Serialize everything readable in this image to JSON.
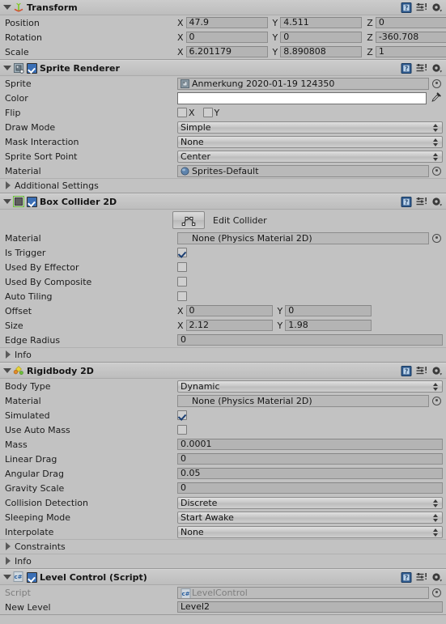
{
  "panel": {
    "name": "Unity Inspector"
  },
  "header_icons": {
    "help": "help-book-icon",
    "preset": "preset-icon",
    "settings": "gear-icon"
  },
  "components": [
    {
      "id": "transform",
      "title": "Transform",
      "icon": "transform-axis-icon",
      "has_checkbox": false,
      "rows": [
        {
          "label": "Position",
          "type": "vector3",
          "x": "47.9",
          "y": "4.511",
          "z": "0"
        },
        {
          "label": "Rotation",
          "type": "vector3",
          "x": "0",
          "y": "0",
          "z": "-360.708"
        },
        {
          "label": "Scale",
          "type": "vector3",
          "x": "6.201179",
          "y": "8.890808",
          "z": "1"
        }
      ]
    },
    {
      "id": "sprite-renderer",
      "title": "Sprite Renderer",
      "icon": "sprite-renderer-icon",
      "has_checkbox": true,
      "enabled": true,
      "rows": [
        {
          "label": "Sprite",
          "type": "object",
          "value": "Anmerkung 2020-01-19 124350",
          "icon": "sprite-asset-icon"
        },
        {
          "label": "Color",
          "type": "color",
          "value": "#ffffff"
        },
        {
          "label": "Flip",
          "type": "flip",
          "x_label": "X",
          "y_label": "Y",
          "x_checked": false,
          "y_checked": false
        },
        {
          "label": "Draw Mode",
          "type": "dropdown",
          "value": "Simple"
        },
        {
          "label": "Mask Interaction",
          "type": "dropdown",
          "value": "None"
        },
        {
          "label": "Sprite Sort Point",
          "type": "dropdown",
          "value": "Center"
        },
        {
          "label": "Material",
          "type": "object",
          "value": "Sprites-Default",
          "icon": "material-sphere-icon"
        },
        {
          "label": "Additional Settings",
          "type": "foldout"
        }
      ]
    },
    {
      "id": "box-collider-2d",
      "title": "Box Collider 2D",
      "icon": "box-collider-2d-icon",
      "has_checkbox": true,
      "enabled": true,
      "rows": [
        {
          "label": "Edit Collider",
          "type": "button",
          "icon": "edit-collider-icon"
        },
        {
          "label": "Material",
          "type": "object",
          "value": "None (Physics Material 2D)",
          "icon": "none-icon"
        },
        {
          "label": "Is Trigger",
          "type": "checkbox",
          "checked": true
        },
        {
          "label": "Used By Effector",
          "type": "checkbox",
          "checked": false
        },
        {
          "label": "Used By Composite",
          "type": "checkbox",
          "checked": false
        },
        {
          "label": "Auto Tiling",
          "type": "checkbox",
          "checked": false
        },
        {
          "label": "Offset",
          "type": "vector2",
          "x": "0",
          "y": "0"
        },
        {
          "label": "Size",
          "type": "vector2",
          "x": "2.12",
          "y": "1.98"
        },
        {
          "label": "Edge Radius",
          "type": "text",
          "value": "0"
        },
        {
          "label": "Info",
          "type": "foldout"
        }
      ]
    },
    {
      "id": "rigidbody-2d",
      "title": "Rigidbody 2D",
      "icon": "rigidbody-2d-icon",
      "has_checkbox": false,
      "rows": [
        {
          "label": "Body Type",
          "type": "dropdown",
          "value": "Dynamic"
        },
        {
          "label": "Material",
          "type": "object",
          "value": "None (Physics Material 2D)",
          "icon": "none-icon"
        },
        {
          "label": "Simulated",
          "type": "checkbox",
          "checked": true
        },
        {
          "label": "Use Auto Mass",
          "type": "checkbox",
          "checked": false
        },
        {
          "label": "Mass",
          "type": "text",
          "value": "0.0001"
        },
        {
          "label": "Linear Drag",
          "type": "text",
          "value": "0"
        },
        {
          "label": "Angular Drag",
          "type": "text",
          "value": "0.05"
        },
        {
          "label": "Gravity Scale",
          "type": "text",
          "value": "0"
        },
        {
          "label": "Collision Detection",
          "type": "dropdown",
          "value": "Discrete"
        },
        {
          "label": "Sleeping Mode",
          "type": "dropdown",
          "value": "Start Awake"
        },
        {
          "label": "Interpolate",
          "type": "dropdown",
          "value": "None"
        },
        {
          "label": "Constraints",
          "type": "foldout"
        },
        {
          "label": "Info",
          "type": "foldout"
        }
      ]
    },
    {
      "id": "level-control-script",
      "title": "Level Control (Script)",
      "icon": "csharp-script-icon",
      "has_checkbox": true,
      "enabled": true,
      "rows": [
        {
          "label": "Script",
          "type": "object",
          "value": "LevelControl",
          "icon": "csharp-script-icon",
          "dim": true
        },
        {
          "label": "New Level",
          "type": "text",
          "value": "Level2"
        }
      ]
    }
  ]
}
